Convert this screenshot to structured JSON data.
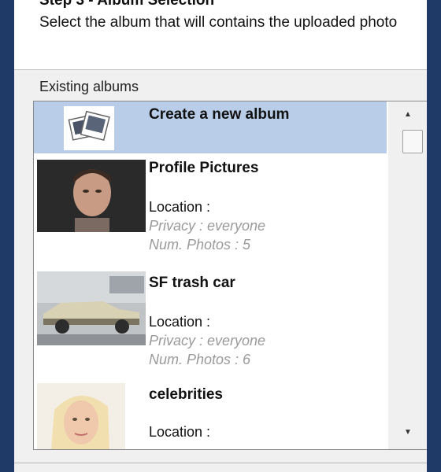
{
  "header": {
    "step_title": "Step 3 - Album Selection",
    "step_description": "Select the album that will contains the uploaded photo"
  },
  "albums_section": {
    "label": "Existing albums",
    "items": [
      {
        "name": "Create a new album",
        "selected": true,
        "icon": "photo-stack-icon"
      },
      {
        "name": "Profile Pictures",
        "location": "Location :",
        "privacy": "Privacy : everyone",
        "photos": "Num. Photos : 5"
      },
      {
        "name": "SF trash car",
        "location": "Location :",
        "privacy": "Privacy : everyone",
        "photos": "Num. Photos : 6"
      },
      {
        "name": "celebrities",
        "location": "Location :"
      }
    ]
  },
  "scrollbar": {
    "up_glyph": "▲",
    "down_glyph": "▼"
  },
  "colors": {
    "selection": "#b9cde8",
    "muted_text": "#9a9a9a",
    "window_frame": "#1f3a66"
  }
}
